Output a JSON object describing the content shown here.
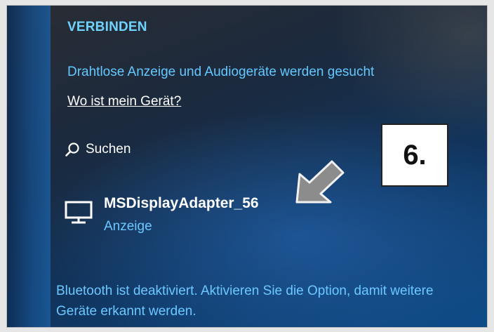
{
  "panel": {
    "heading": "VERBINDEN",
    "status_text": "Drahtlose Anzeige und Audiogeräte werden gesucht",
    "help_link": "Wo ist mein Gerät?",
    "search_label": "Suchen",
    "device": {
      "name": "MSDisplayAdapter_56",
      "type": "Anzeige",
      "icon": "monitor-icon"
    },
    "bluetooth_note": "Bluetooth ist deaktiviert. Aktivieren Sie die Option, damit weitere Geräte erkannt werden."
  },
  "annotation": {
    "step_label": "6.",
    "arrow_icon": "pointer-arrow-icon"
  },
  "colors": {
    "accent": "#64c8ff",
    "text": "#ffffff",
    "background": "#10355f"
  }
}
